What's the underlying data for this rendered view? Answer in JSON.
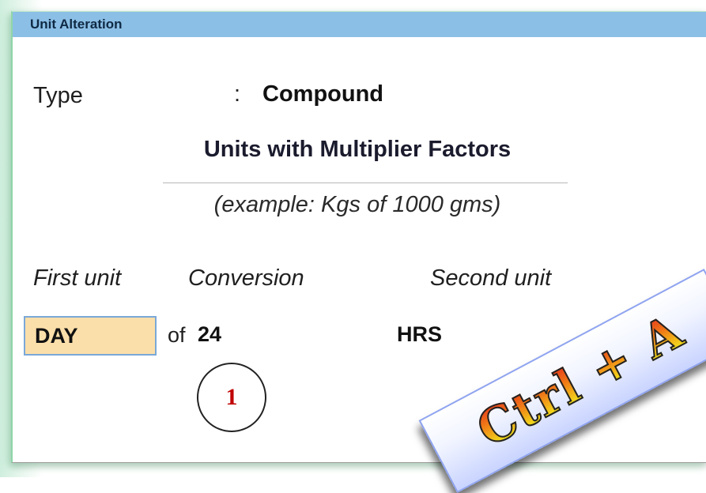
{
  "window": {
    "title": "Unit Alteration"
  },
  "type_row": {
    "label": "Type",
    "separator": ":",
    "value": "Compound"
  },
  "section": {
    "heading": "Units with Multiplier Factors",
    "example": "(example: Kgs of 1000 gms)"
  },
  "columns": {
    "first_unit": "First unit",
    "conversion": "Conversion",
    "second_unit": "Second unit"
  },
  "entry": {
    "first_unit": "DAY",
    "of_label": "of",
    "conversion": "24",
    "second_unit": "HRS"
  },
  "annotation": {
    "step_number": "1"
  },
  "shortcut_banner": {
    "text": "Ctrl + A"
  },
  "colors": {
    "titlebar": "#8bbfe6",
    "input_highlight": "#fbdfaa",
    "input_border": "#7aa8d8",
    "step_number": "#c00000"
  }
}
